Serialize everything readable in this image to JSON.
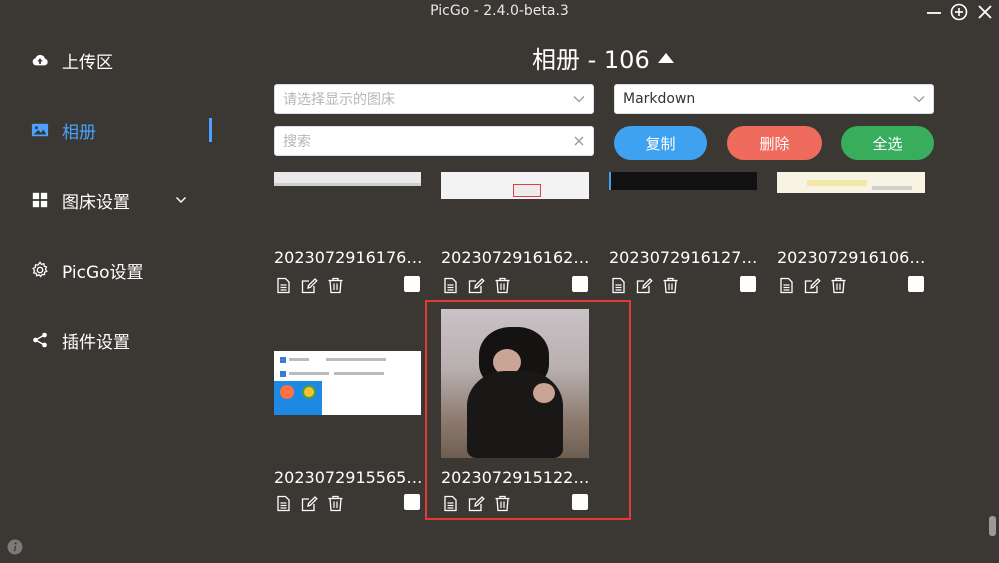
{
  "window": {
    "title": "PicGo - 2.4.0-beta.3"
  },
  "sidebar": {
    "items": [
      {
        "label": "上传区",
        "icon": "cloud-upload-icon"
      },
      {
        "label": "相册",
        "icon": "image-icon",
        "active": true
      },
      {
        "label": "图床设置",
        "icon": "grid-icon",
        "expandable": true
      },
      {
        "label": "PicGo设置",
        "icon": "gear-icon"
      },
      {
        "label": "插件设置",
        "icon": "share-icon"
      }
    ]
  },
  "album": {
    "title": "相册 - 106",
    "filter_placeholder": "请选择显示的图床",
    "format_value": "Markdown",
    "search_placeholder": "搜索",
    "buttons": {
      "copy": "复制",
      "delete": "删除",
      "select_all": "全选"
    },
    "button_colors": {
      "copy": "#3fa2f0",
      "delete": "#ef6b5e",
      "select_all": "#38ad5c"
    }
  },
  "gallery": {
    "items": [
      {
        "name": "2023072916176…"
      },
      {
        "name": "2023072916162…"
      },
      {
        "name": "2023072916127…"
      },
      {
        "name": "2023072916106…"
      },
      {
        "name": "2023072915565…"
      },
      {
        "name": "2023072915122…"
      }
    ]
  },
  "accent_color": "#4aa1ff",
  "highlight_color": "#e53935"
}
